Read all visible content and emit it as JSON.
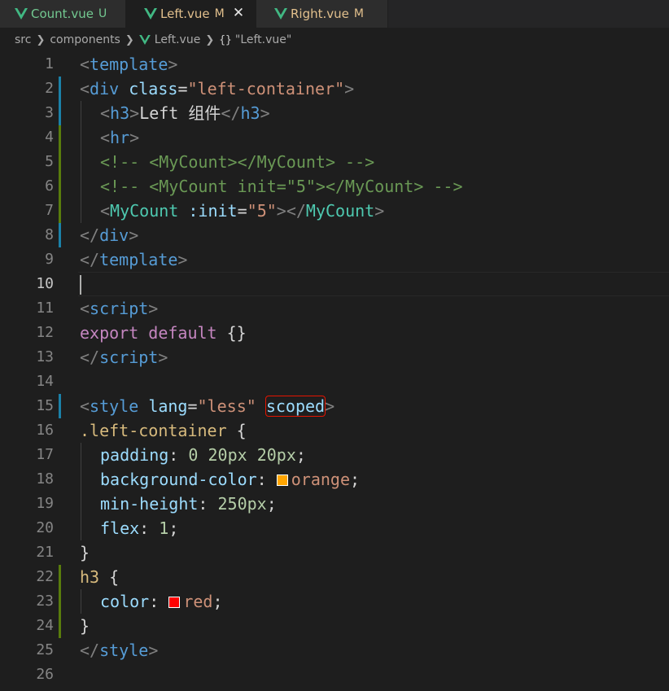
{
  "tabs": [
    {
      "name": "Count.vue",
      "badge": "U"
    },
    {
      "name": "Left.vue",
      "badge": "M"
    },
    {
      "name": "Right.vue",
      "badge": "M"
    }
  ],
  "breadcrumb": {
    "part1": "src",
    "part2": "components",
    "part3": "Left.vue",
    "part4": "\"Left.vue\""
  },
  "colors": {
    "orange_swatch": "#ffa500",
    "red_swatch": "#ff0000"
  },
  "code": {
    "l1": {
      "open": "<",
      "tag": "template",
      "close": ">"
    },
    "l2": {
      "open": "<",
      "tag": "div",
      "attr": "class",
      "eq": "=",
      "val": "\"left-container\"",
      "close": ">"
    },
    "l3": {
      "open": "<",
      "tag": "h3",
      "close": ">",
      "text": "Left 组件",
      "open2": "</",
      "tag2": "h3",
      "close2": ">"
    },
    "l4": {
      "open": "<",
      "tag": "hr",
      "close": ">"
    },
    "l5": {
      "comment": "<!-- <MyCount></MyCount> -->"
    },
    "l6": {
      "comment": "<!-- <MyCount init=\"5\"></MyCount> -->"
    },
    "l7": {
      "open": "<",
      "tag": "MyCount",
      "attr": ":init",
      "eq": "=",
      "val": "\"5\"",
      "close": ">",
      "open2": "</",
      "tag2": "MyCount",
      "close2": ">"
    },
    "l8": {
      "open": "</",
      "tag": "div",
      "close": ">"
    },
    "l9": {
      "open": "</",
      "tag": "template",
      "close": ">"
    },
    "l11": {
      "open": "<",
      "tag": "script",
      "close": ">"
    },
    "l12": {
      "kw1": "export",
      "kw2": "default",
      "obj": "{}"
    },
    "l13": {
      "open": "</",
      "tag": "script",
      "close": ">"
    },
    "l15": {
      "open": "<",
      "tag": "style",
      "attr": "lang",
      "eq": "=",
      "val": "\"less\"",
      "attr2": "scoped",
      "close": ">"
    },
    "l16": {
      "selector": ".left-container",
      "brace": "{"
    },
    "l17": {
      "prop": "padding",
      "colon": ":",
      "v1": "0",
      "v2": "20px",
      "v3": "20px",
      "semi": ";"
    },
    "l18": {
      "prop": "background-color",
      "colon": ":",
      "value": "orange",
      "semi": ";"
    },
    "l19": {
      "prop": "min-height",
      "colon": ":",
      "value": "250px",
      "semi": ";"
    },
    "l20": {
      "prop": "flex",
      "colon": ":",
      "value": "1",
      "semi": ";"
    },
    "l21": {
      "brace": "}"
    },
    "l22": {
      "selector": "h3",
      "brace": "{"
    },
    "l23": {
      "prop": "color",
      "colon": ":",
      "value": "red",
      "semi": ";"
    },
    "l24": {
      "brace": "}"
    },
    "l25": {
      "open": "</",
      "tag": "style",
      "close": ">"
    }
  },
  "line_numbers": [
    "1",
    "2",
    "3",
    "4",
    "5",
    "6",
    "7",
    "8",
    "9",
    "10",
    "11",
    "12",
    "13",
    "14",
    "15",
    "16",
    "17",
    "18",
    "19",
    "20",
    "21",
    "22",
    "23",
    "24",
    "25",
    "26"
  ]
}
